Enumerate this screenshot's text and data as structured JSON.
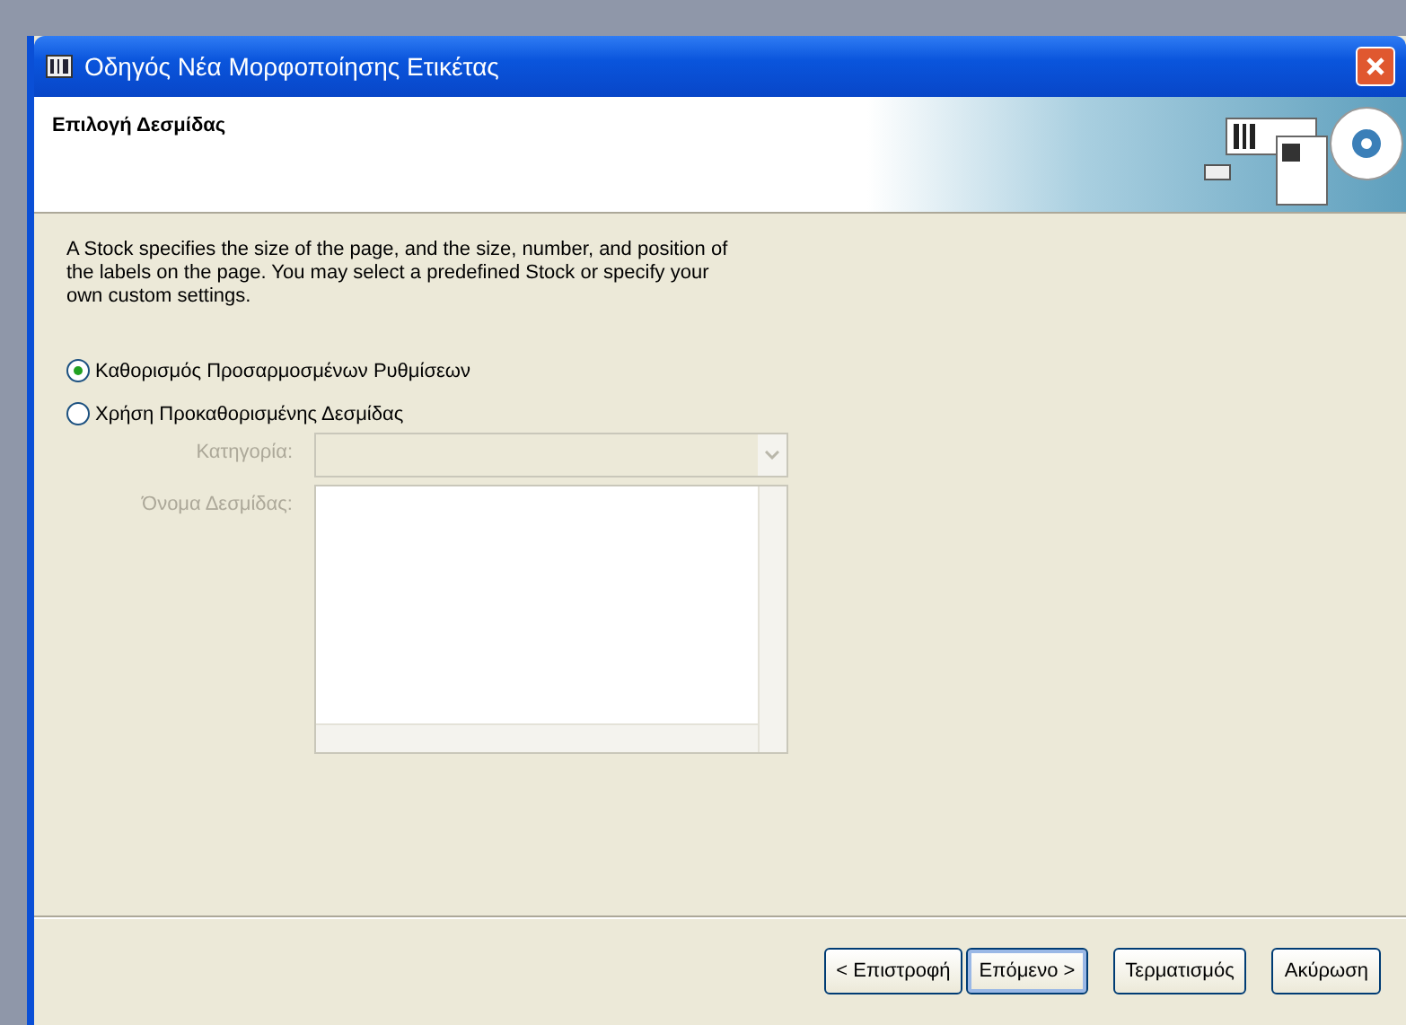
{
  "window": {
    "title": "Οδηγός Νέα Μορφοποίησης Ετικέτας"
  },
  "header": {
    "title": "Επιλογή Δεσμίδας"
  },
  "description": "A Stock specifies the size of the page, and the size, number, and position of the labels on the page. You may select a predefined Stock or specify your own custom settings.",
  "options": [
    {
      "label": "Καθορισμός Προσαρμοσμένων Ρυθμίσεων",
      "selected": true
    },
    {
      "label": "Χρήση Προκαθορισμένης Δεσμίδας",
      "selected": false
    }
  ],
  "fields": [
    {
      "kind": "dropdown",
      "label": "Κατηγορία:",
      "disabled": true
    },
    {
      "kind": "list",
      "label": "Όνομα Δεσμίδας:",
      "disabled": true
    }
  ],
  "buttons": [
    {
      "label": "< Επιστροφή",
      "default": false
    },
    {
      "label": "Επόμενο >",
      "default": true
    },
    {
      "label": "Τερματισμός",
      "default": false
    },
    {
      "label": "Ακύρωση",
      "default": false
    }
  ]
}
